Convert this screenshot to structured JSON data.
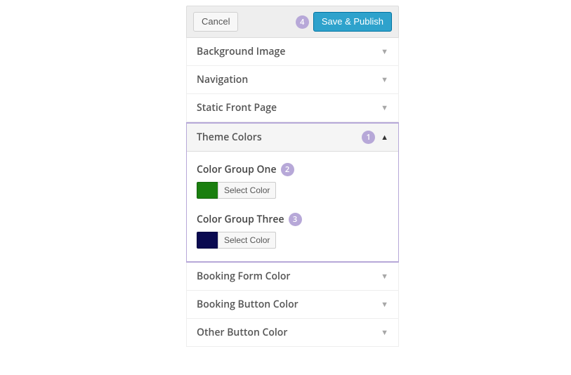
{
  "header": {
    "cancel_label": "Cancel",
    "save_label": "Save & Publish",
    "save_badge_num": "4"
  },
  "sections": {
    "background_image": "Background Image",
    "navigation": "Navigation",
    "static_front_page": "Static Front Page",
    "theme_colors": "Theme Colors",
    "booking_form_color": "Booking Form Color",
    "booking_button_color": "Booking Button Color",
    "other_button_color": "Other Button Color"
  },
  "theme_colors_badge_num": "1",
  "color_groups": {
    "one": {
      "label": "Color Group One",
      "badge_num": "2",
      "swatch_hex": "#1a7f0f",
      "button_label": "Select Color"
    },
    "three": {
      "label": "Color Group Three",
      "badge_num": "3",
      "swatch_hex": "#0a0a50",
      "button_label": "Select Color"
    }
  }
}
